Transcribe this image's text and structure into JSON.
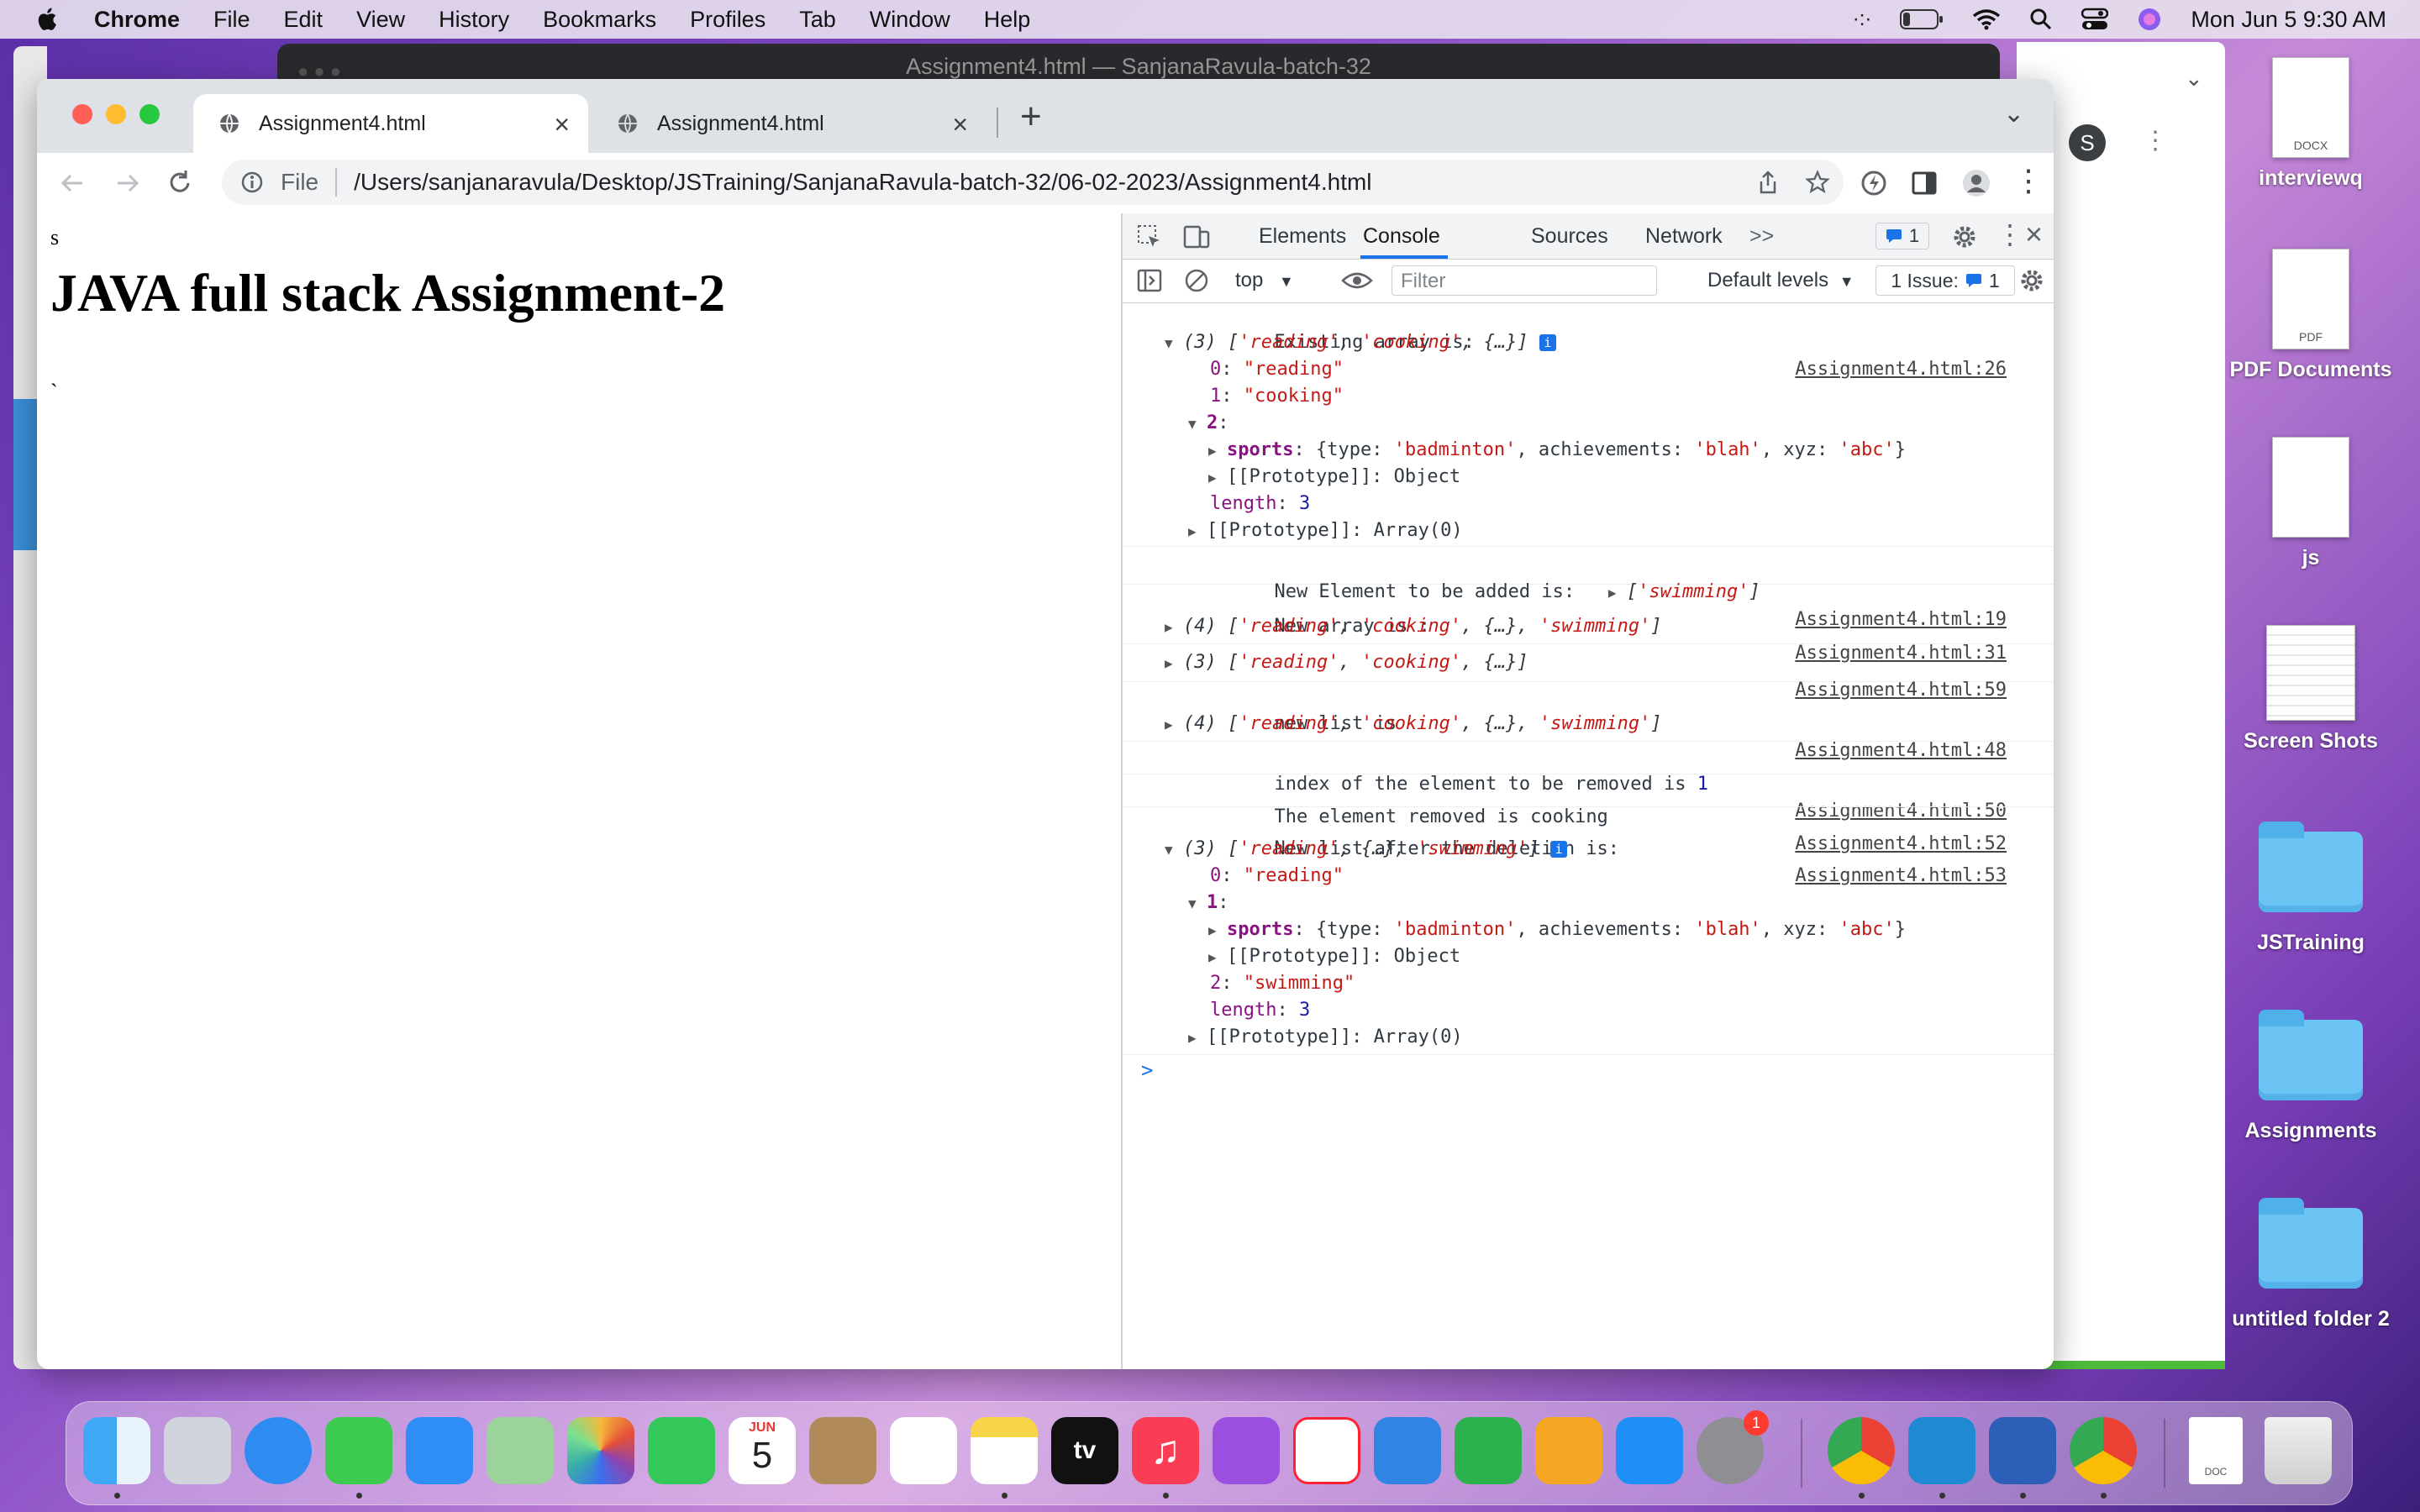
{
  "menubar": {
    "app": "Chrome",
    "items": [
      "File",
      "Edit",
      "View",
      "History",
      "Bookmarks",
      "Profiles",
      "Tab",
      "Window",
      "Help"
    ],
    "clock": "Mon Jun 5  9:30 AM"
  },
  "background_window": {
    "title": "Assignment4.html — SanjanaRavula-batch-32"
  },
  "chrome": {
    "tabs": [
      {
        "title": "Assignment4.html",
        "active": true
      },
      {
        "title": "Assignment4.html",
        "active": false
      }
    ],
    "new_tab": "+",
    "omnibox": {
      "scheme": "File",
      "url": "/Users/sanjanaravula/Desktop/JSTraining/SanjanaRavula-batch-32/06-02-2023/Assignment4.html"
    },
    "profile_initial": "S"
  },
  "page": {
    "text_s": "s",
    "heading": "JAVA full stack Assignment-2",
    "backtick": "`"
  },
  "devtools": {
    "tabs": [
      "Elements",
      "Console",
      "Sources",
      "Network"
    ],
    "active_tab": "Console",
    "more": ">>",
    "badge_count": "1",
    "context": "top",
    "filter_placeholder": "Filter",
    "levels": "Default levels",
    "issues_label": "1 Issue:",
    "issues_count": "1",
    "prompt": ">"
  },
  "console": {
    "src26": "Assignment4.html:26",
    "src19": "Assignment4.html:19",
    "src31": "Assignment4.html:31",
    "src59": "Assignment4.html:59",
    "src48": "Assignment4.html:48",
    "src50": "Assignment4.html:50",
    "src52": "Assignment4.html:52",
    "src53": "Assignment4.html:53",
    "m1_label": "Existing array is:",
    "m2_label": "New Element to be added is:",
    "m3_label": "New array is :",
    "m5_label": "new list is",
    "m6_label": "index of the element to be removed is",
    "m6_value": "1",
    "m7_label": "The element removed is cooking",
    "m8_label": "New list after the deletion is:",
    "reading": "\"reading\"",
    "cooking": "\"cooking\"",
    "swimming": "\"swimming\"",
    "length_val": "3"
  },
  "desktop_icons": [
    "interviewq",
    "PDF Documents",
    "js",
    "Screen Shots",
    "JSTraining",
    "Assignments",
    "untitled folder 2"
  ],
  "desktop_icon_tags": {
    "docx": "DOCX",
    "pdf": "PDF",
    "doc": "DOC"
  },
  "dock": {
    "calendar_month": "JUN",
    "calendar_day": "5",
    "tv_label": "tv",
    "settings_badge": "1"
  },
  "colors": {
    "accent": "#1a73e8",
    "string": "#c41a16",
    "key": "#881280",
    "number": "#1a1aa6"
  }
}
